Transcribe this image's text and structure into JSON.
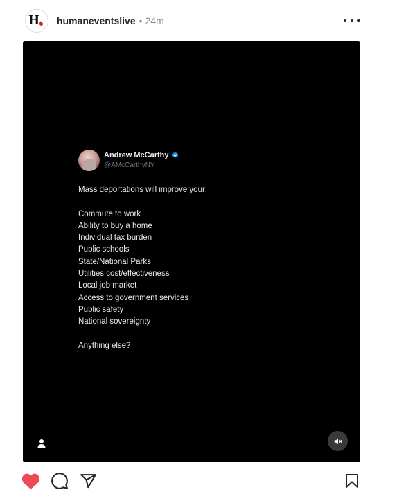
{
  "post": {
    "username": "humaneventslive",
    "separator": "•",
    "time": "24m",
    "avatar_letter": "H."
  },
  "tweet": {
    "name": "Andrew McCarthy",
    "handle": "@AMcCarthyNY",
    "intro": "Mass deportations will improve your:",
    "items": [
      "Commute to work",
      "Ability to buy a home",
      "Individual tax burden",
      "Public schools",
      "State/National Parks",
      "Utilities cost/effectiveness",
      "Local job market",
      "Access to government services",
      "Public safety",
      "National sovereignty"
    ],
    "closing": "Anything else?"
  },
  "colors": {
    "like": "#ed4956",
    "verified": "#1d9bf0",
    "brand_dot": "#d8232a"
  },
  "icons": {
    "more": "more-options-icon",
    "person": "person-tag-icon",
    "mute": "speaker-muted-icon",
    "like": "heart-filled-icon",
    "comment": "comment-icon",
    "share": "paper-plane-icon",
    "save": "bookmark-icon"
  }
}
